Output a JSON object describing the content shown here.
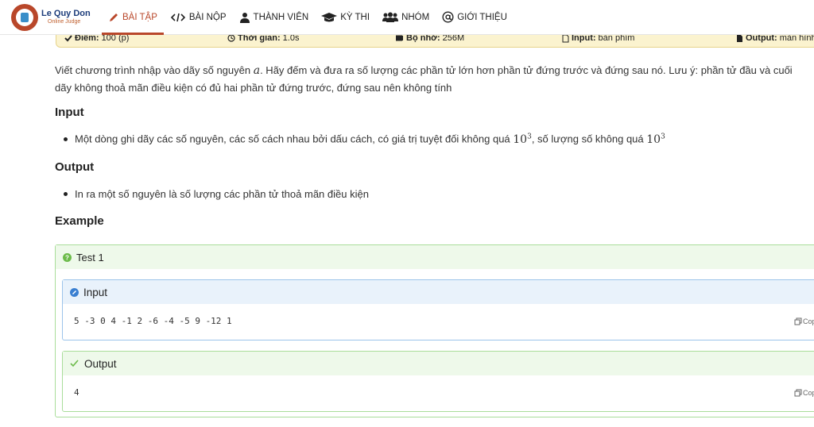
{
  "brand": {
    "title": "Le Quy Don",
    "subtitle": "Online Judge"
  },
  "nav": [
    {
      "label": "BÀI TẬP",
      "icon": "pencil-icon",
      "active": true
    },
    {
      "label": "BÀI NỘP",
      "icon": "code-icon",
      "active": false
    },
    {
      "label": "THÀNH VIÊN",
      "icon": "user-icon",
      "active": false
    },
    {
      "label": "KỲ THI",
      "icon": "graduation-cap-icon",
      "active": false
    },
    {
      "label": "NHÓM",
      "icon": "users-icon",
      "active": false
    },
    {
      "label": "GIỚI THIỆU",
      "icon": "at-icon",
      "active": false
    }
  ],
  "info": {
    "points_label": "Điểm:",
    "points_value": "100 (p)",
    "time_label": "Thời gian:",
    "time_value": "1.0s",
    "memory_label": "Bộ nhớ:",
    "memory_value": "256M",
    "input_label": "Input:",
    "input_value": "bàn phím",
    "output_label": "Output:",
    "output_value": "màn hình"
  },
  "statement": {
    "part1": "Viết chương trình nhập vào dãy số nguyên ",
    "var": "a",
    "part2": ". Hãy đếm và đưa ra số lượng các phần tử lớn hơn phần tử đứng trước và đứng sau nó. Lưu ý: phần tử đầu và cuối dãy không thoả mãn điều kiện có đủ hai phần tử đứng trước, đứng sau nên không tính"
  },
  "input_section": {
    "heading": "Input",
    "bullet_part1": "Một dòng ghi dãy các số nguyên, các số cách nhau bởi dấu cách, có giá trị tuyệt đối không quá ",
    "bullet_part2": ", số lượng số không quá ",
    "math_base": "10",
    "math_exp": "3"
  },
  "output_section": {
    "heading": "Output",
    "bullet": "In ra một số nguyên là số lượng các phần tử thoả mãn điều kiện"
  },
  "example": {
    "heading": "Example",
    "test_title": "Test 1",
    "input_title": "Input",
    "input_value": "5 -3 0 4 -1 2 -6 -4 -5 9 -12 1",
    "output_title": "Output",
    "output_value": "4",
    "copy_label": "Copy"
  }
}
